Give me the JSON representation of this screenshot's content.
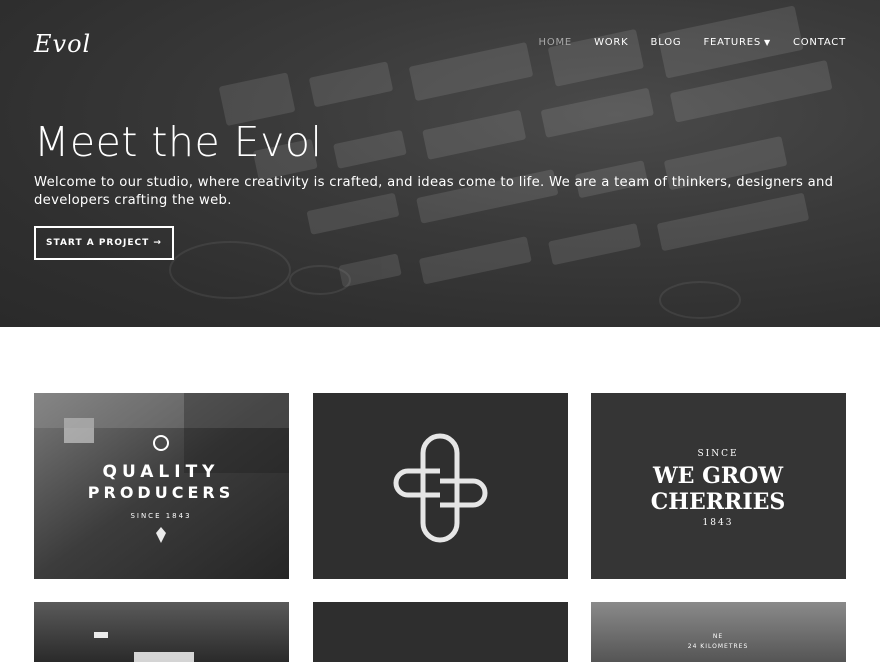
{
  "brand": {
    "logo_text": "Evol"
  },
  "nav": {
    "items": [
      {
        "label": "HOME",
        "active": true
      },
      {
        "label": "WORK",
        "active": false
      },
      {
        "label": "BLOG",
        "active": false
      },
      {
        "label": "FEATURES",
        "active": false,
        "has_dropdown": true
      },
      {
        "label": "CONTACT",
        "active": false
      }
    ]
  },
  "hero": {
    "title": "Meet the Evol",
    "text": "Welcome to our studio, where creativity is crafted, and ideas come to life. We are a team of thinkers, designers and developers crafting the web.",
    "cta_label": "START A PROJECT →"
  },
  "portfolio": {
    "tiles": [
      {
        "line1": "QUALITY",
        "line2": "PRODUCERS",
        "line3": "SINCE 1843"
      },
      {
        "icon": "knot-monogram-icon"
      },
      {
        "line1": "SINCE",
        "line2": "WE GROW",
        "line3": "CHERRIES",
        "line4": "1843"
      },
      {
        "line1": ""
      },
      {
        "line1": ""
      },
      {
        "line1": "NE",
        "line2": "24 KILOMETRES"
      }
    ]
  },
  "colors": {
    "hero_bg": "#333333",
    "nav_active": "#a9a9a9",
    "text_light": "#ffffff",
    "page_bg": "#ffffff"
  }
}
